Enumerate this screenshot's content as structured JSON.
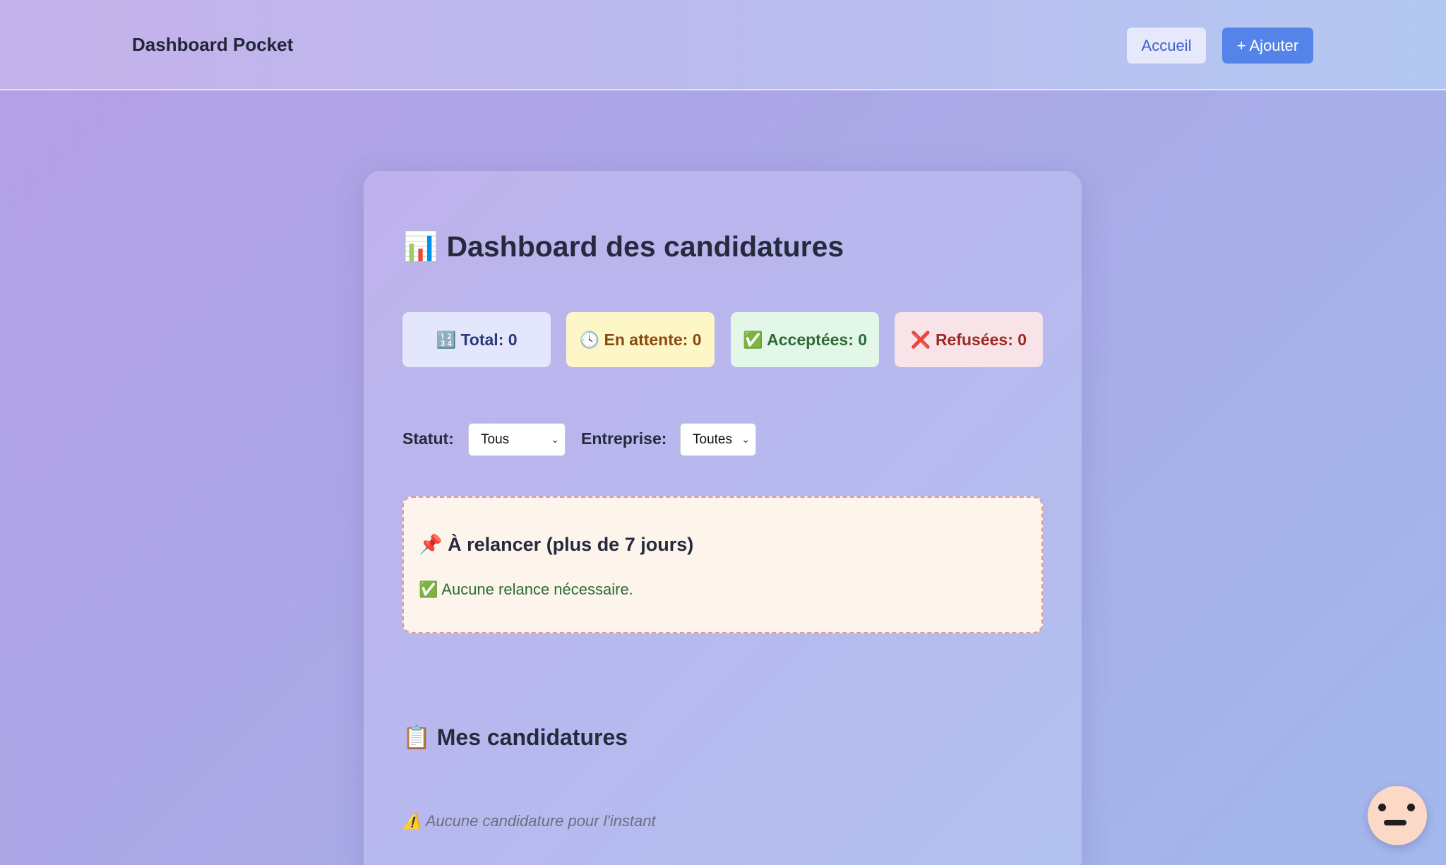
{
  "header": {
    "brand": "Dashboard Pocket",
    "nav": {
      "home_label": "Accueil",
      "add_label": "+ Ajouter"
    }
  },
  "main": {
    "title": "📊 Dashboard des candidatures",
    "stats": {
      "total": "🔢 Total: 0",
      "pending": "🕓 En attente: 0",
      "accepted": "✅ Acceptées: 0",
      "refused": "❌ Refusées: 0"
    },
    "filters": {
      "status_label": "Statut:",
      "status_value": "Tous",
      "company_label": "Entreprise:",
      "company_value": "Toutes"
    },
    "relance": {
      "title": "📌 À relancer (plus de 7 jours)",
      "message": "✅ Aucune relance nécessaire."
    },
    "applications": {
      "title": "📋 Mes candidatures",
      "empty": "⚠️ Aucune candidature pour l'instant"
    }
  },
  "assistant": {
    "icon": "face-icon"
  },
  "colors": {
    "accent": "#5484ea",
    "stat_total_bg": "#e4e6fb",
    "stat_pending_bg": "#fdf6c6",
    "stat_accepted_bg": "#e2f7e8",
    "stat_refused_bg": "#f8e3e8",
    "relance_bg": "#fdf5ec"
  }
}
